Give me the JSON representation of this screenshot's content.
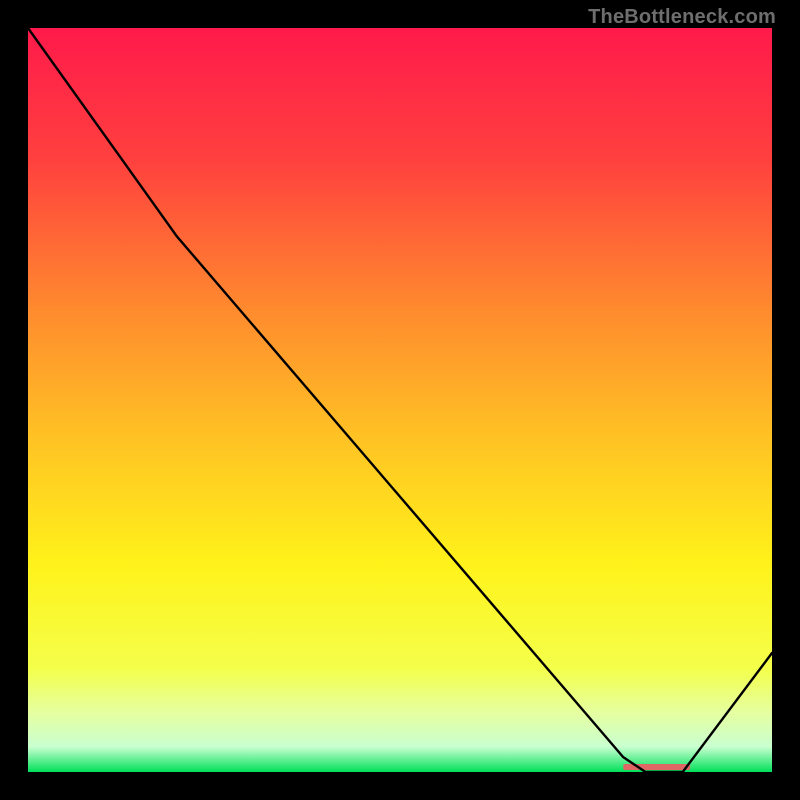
{
  "watermark": "TheBottleneck.com",
  "chart_data": {
    "type": "line",
    "title": "",
    "xlabel": "",
    "ylabel": "",
    "xlim": [
      0,
      100
    ],
    "ylim": [
      0,
      100
    ],
    "x": [
      0,
      20,
      80,
      83,
      88,
      100
    ],
    "values": [
      100,
      72,
      2,
      0,
      0,
      16
    ],
    "marker_region": {
      "x_start": 80,
      "x_end": 89,
      "color": "#e06666"
    },
    "gradient_stops": [
      {
        "offset": 0.0,
        "color": "#ff1a4b"
      },
      {
        "offset": 0.18,
        "color": "#ff413e"
      },
      {
        "offset": 0.38,
        "color": "#ff8b2e"
      },
      {
        "offset": 0.55,
        "color": "#ffc224"
      },
      {
        "offset": 0.72,
        "color": "#fff21a"
      },
      {
        "offset": 0.86,
        "color": "#f4ff4a"
      },
      {
        "offset": 0.92,
        "color": "#e6ffa0"
      },
      {
        "offset": 0.966,
        "color": "#c9ffd0"
      },
      {
        "offset": 1.0,
        "color": "#00e05a"
      }
    ]
  }
}
